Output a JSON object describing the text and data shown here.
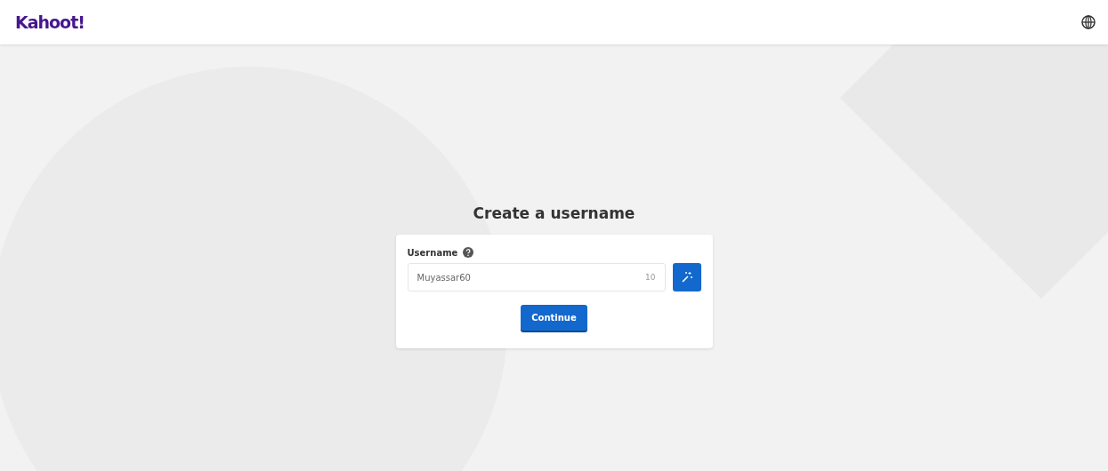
{
  "header": {
    "logo": "Kahoot!"
  },
  "main": {
    "title": "Create a username",
    "field": {
      "label": "Username",
      "value": "Muyassar60",
      "counter": "10"
    },
    "button": "Continue"
  }
}
